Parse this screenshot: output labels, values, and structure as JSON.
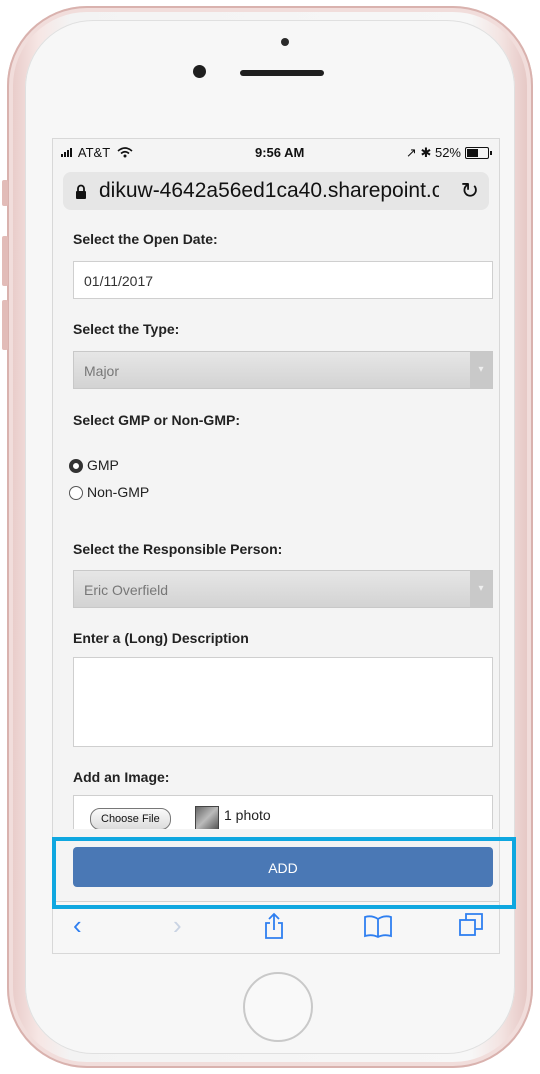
{
  "status_bar": {
    "carrier": "AT&T",
    "time": "9:56 AM",
    "battery": "52%",
    "battery_level": 0.52
  },
  "address_bar": {
    "url": "dikuw-4642a56ed1ca40.sharepoint.c",
    "lock_icon": "lock-icon",
    "reload_icon": "reload-icon"
  },
  "form": {
    "open_date_label": "Select the Open Date:",
    "open_date_value": "01/11/2017",
    "type_label": "Select the Type:",
    "type_value": "Major",
    "gmp_label": "Select GMP or Non-GMP:",
    "gmp_options": [
      {
        "label": "GMP",
        "selected": true
      },
      {
        "label": "Non-GMP",
        "selected": false
      }
    ],
    "person_label": "Select the Responsible Person:",
    "person_value": "Eric Overfield",
    "description_label": "Enter a (Long) Description",
    "description_value": "",
    "image_label": "Add an Image:",
    "choose_file_label": "Choose File",
    "photo_count": "1 photo"
  },
  "add_button_label": "ADD",
  "toolbar": {
    "icons": [
      "back-icon",
      "forward-icon",
      "share-icon",
      "bookmarks-icon",
      "tabs-icon"
    ]
  },
  "colors": {
    "accent": "#4a78b5",
    "highlight": "#0fa7e0",
    "toolbar_icon": "#2f7ff0"
  }
}
